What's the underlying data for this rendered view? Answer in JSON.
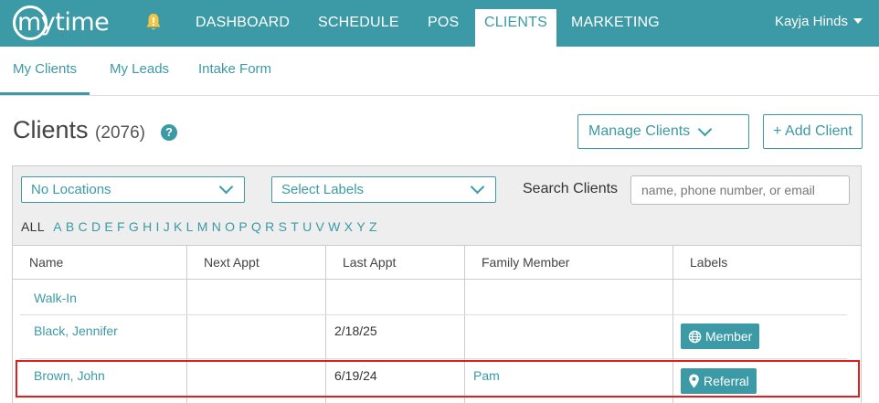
{
  "nav": {
    "logo": "mytime",
    "items": [
      "DASHBOARD",
      "SCHEDULE",
      "POS",
      "CLIENTS",
      "MARKETING"
    ],
    "active": "CLIENTS",
    "user": "Kayja Hinds",
    "bell_icon": "bell-icon"
  },
  "subnav": {
    "items": [
      "My Clients",
      "My Leads",
      "Intake Form"
    ],
    "active": "My Clients"
  },
  "page": {
    "title": "Clients",
    "count": "(2076)",
    "help": "?",
    "manage_label": "Manage Clients",
    "add_label": "+ Add Client"
  },
  "filters": {
    "locations": "No Locations",
    "labels": "Select Labels",
    "search_label": "Search Clients",
    "search_placeholder": "name, phone number, or email",
    "all": "ALL",
    "letters": [
      "A",
      "B",
      "C",
      "D",
      "E",
      "F",
      "G",
      "H",
      "I",
      "J",
      "K",
      "L",
      "M",
      "N",
      "O",
      "P",
      "Q",
      "R",
      "S",
      "T",
      "U",
      "V",
      "W",
      "X",
      "Y",
      "Z"
    ]
  },
  "table": {
    "columns": [
      "Name",
      "Next Appt",
      "Last Appt",
      "Family Member",
      "Labels"
    ],
    "rows": [
      {
        "name": "Walk-In",
        "next": "",
        "last": "",
        "family": "",
        "label": ""
      },
      {
        "name": "Black, Jennifer",
        "next": "",
        "last": "2/18/25",
        "family": "",
        "label": "Member",
        "label_icon": "globe-icon"
      },
      {
        "name": "Brown, John",
        "next": "",
        "last": "6/19/24",
        "family": "Pam",
        "label": "Referral",
        "label_icon": "location-pin-icon"
      }
    ]
  },
  "colors": {
    "brand": "#3b9aa5",
    "highlight": "#e21d1d"
  }
}
